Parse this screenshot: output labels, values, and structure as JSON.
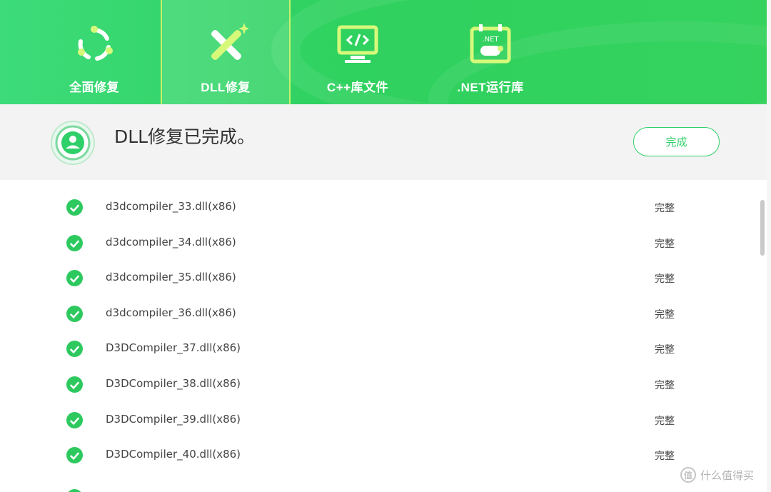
{
  "tabs": [
    {
      "label": "全面修复",
      "icon": "refresh-cycle-icon",
      "active": false
    },
    {
      "label": "DLL修复",
      "icon": "wrench-cross-icon",
      "active": true
    },
    {
      "label": "C++库文件",
      "icon": "code-monitor-icon",
      "active": false
    },
    {
      "label": ".NET运行库",
      "icon": "dotnet-calendar-icon",
      "badge_text": ".NET",
      "active": false
    }
  ],
  "status": {
    "title": "DLL修复已完成。",
    "done_button": "完成",
    "icon": "target-person-icon"
  },
  "files": [
    {
      "name": "d3dcompiler_33.dll(x86)",
      "state": "完整"
    },
    {
      "name": "d3dcompiler_34.dll(x86)",
      "state": "完整"
    },
    {
      "name": "d3dcompiler_35.dll(x86)",
      "state": "完整"
    },
    {
      "name": "d3dcompiler_36.dll(x86)",
      "state": "完整"
    },
    {
      "name": "D3DCompiler_37.dll(x86)",
      "state": "完整"
    },
    {
      "name": "D3DCompiler_38.dll(x86)",
      "state": "完整"
    },
    {
      "name": "D3DCompiler_39.dll(x86)",
      "state": "完整"
    },
    {
      "name": "D3DCompiler_40.dll(x86)",
      "state": "完整"
    }
  ],
  "watermark": {
    "text": "什么值得买",
    "icon_glyph": "值"
  },
  "colors": {
    "brand_green": "#2fd15f",
    "accent_lime": "#c6f26b",
    "check_green": "#2dc95f",
    "text": "#444444"
  }
}
